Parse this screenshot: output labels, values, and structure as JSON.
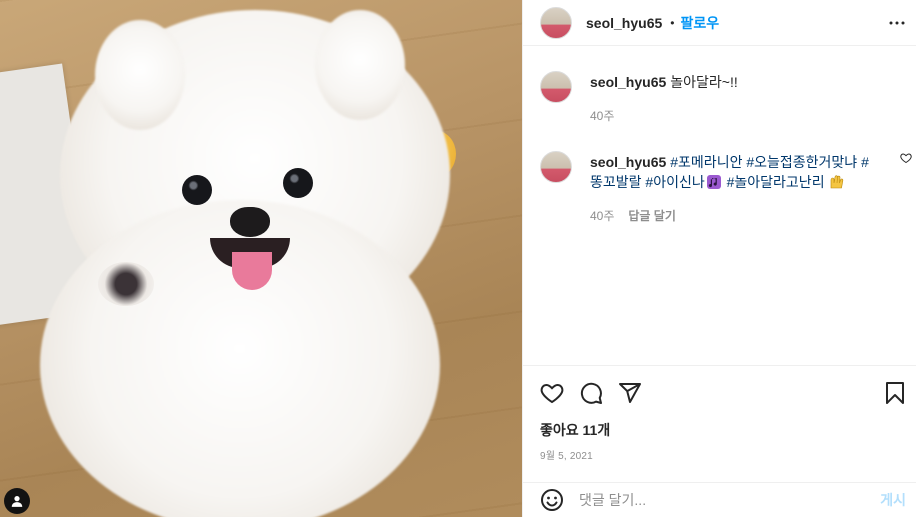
{
  "photo": {
    "alt": "Pomeranian puppy",
    "user_tag_icon": "person-icon"
  },
  "header": {
    "username": "seol_hyu65",
    "separator": "•",
    "follow_label": "팔로우",
    "more_icon": "more-horizontal-icon"
  },
  "comments": [
    {
      "username": "seol_hyu65",
      "text": "놀아달라~!!",
      "time": "40주"
    },
    {
      "username": "seol_hyu65",
      "hashtags": [
        "#포메라니안",
        "#오늘접종한거맞냐",
        "#똥꼬발랄",
        "#아이신나"
      ],
      "hashtag_last": "#놀아달라고난리",
      "emoji_1": "music-notes-emoji",
      "emoji_2": "raised-hands-emoji",
      "time": "40주",
      "reply_label": "답글 달기"
    }
  ],
  "actions": {
    "like_icon": "heart-icon",
    "comment_icon": "comment-icon",
    "share_icon": "paper-plane-icon",
    "save_icon": "bookmark-icon"
  },
  "likes": "좋아요 11개",
  "date": "9월 5, 2021",
  "add_comment": {
    "placeholder": "댓글 달기...",
    "post_label": "게시"
  },
  "colors": {
    "accent": "#0095f6",
    "hashtag": "#00376b",
    "muted": "#8e8e8e",
    "post_disabled": "#b3dffc"
  }
}
